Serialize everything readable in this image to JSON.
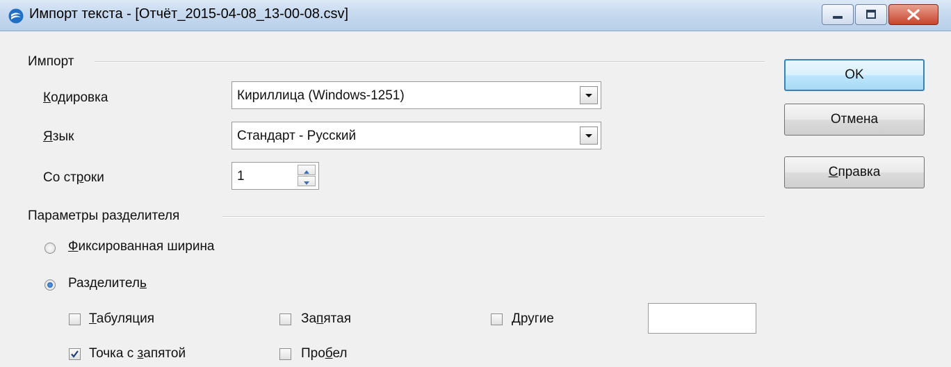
{
  "window": {
    "title": "Импорт текста - [Отчёт_2015-04-08_13-00-08.csv]"
  },
  "import_section": {
    "label": "Импорт",
    "encoding": {
      "label_first": "К",
      "label_rest": "одировка",
      "value": "Кириллица (Windows-1251)"
    },
    "language": {
      "label_first": "Я",
      "label_rest": "зык",
      "value": "Стандарт - Русский"
    },
    "from_row": {
      "label_pre": "Со ст",
      "label_ul": "р",
      "label_post": "оки",
      "value": "1"
    }
  },
  "separator_section": {
    "label": "Параметры разделителя",
    "fixed_width": {
      "label_ul": "Ф",
      "label_rest": "иксированная ширина",
      "selected": false
    },
    "separated": {
      "label_pre": "Разделител",
      "label_ul": "ь",
      "selected": true
    },
    "options": {
      "tab": {
        "label_ul": "Т",
        "label_rest": "абуляция",
        "checked": false
      },
      "comma": {
        "label_pre": "За",
        "label_ul": "п",
        "label_post": "ятая",
        "checked": false
      },
      "other": {
        "label_ul": "Д",
        "label_rest": "ругие",
        "checked": false,
        "value": ""
      },
      "semicolon": {
        "label_pre": "Точка с ",
        "label_ul": "з",
        "label_post": "апятой",
        "checked": true
      },
      "space": {
        "label_pre": "Про",
        "label_ul": "б",
        "label_post": "ел",
        "checked": false
      }
    }
  },
  "buttons": {
    "ok": "OK",
    "cancel": "Отмена",
    "help_ul": "С",
    "help_rest": "правка"
  },
  "icons": {
    "app": "office-suite-icon",
    "minimize": "minimize-icon",
    "maximize": "maximize-icon",
    "close": "close-icon",
    "dropdown": "chevron-down-icon",
    "checkmark": "checkmark-icon"
  },
  "colors": {
    "titlebar": "#c6d9ef",
    "close_button": "#c7442b",
    "default_button_border": "#3c7fb1",
    "radio_dot": "#1f5aa3"
  }
}
